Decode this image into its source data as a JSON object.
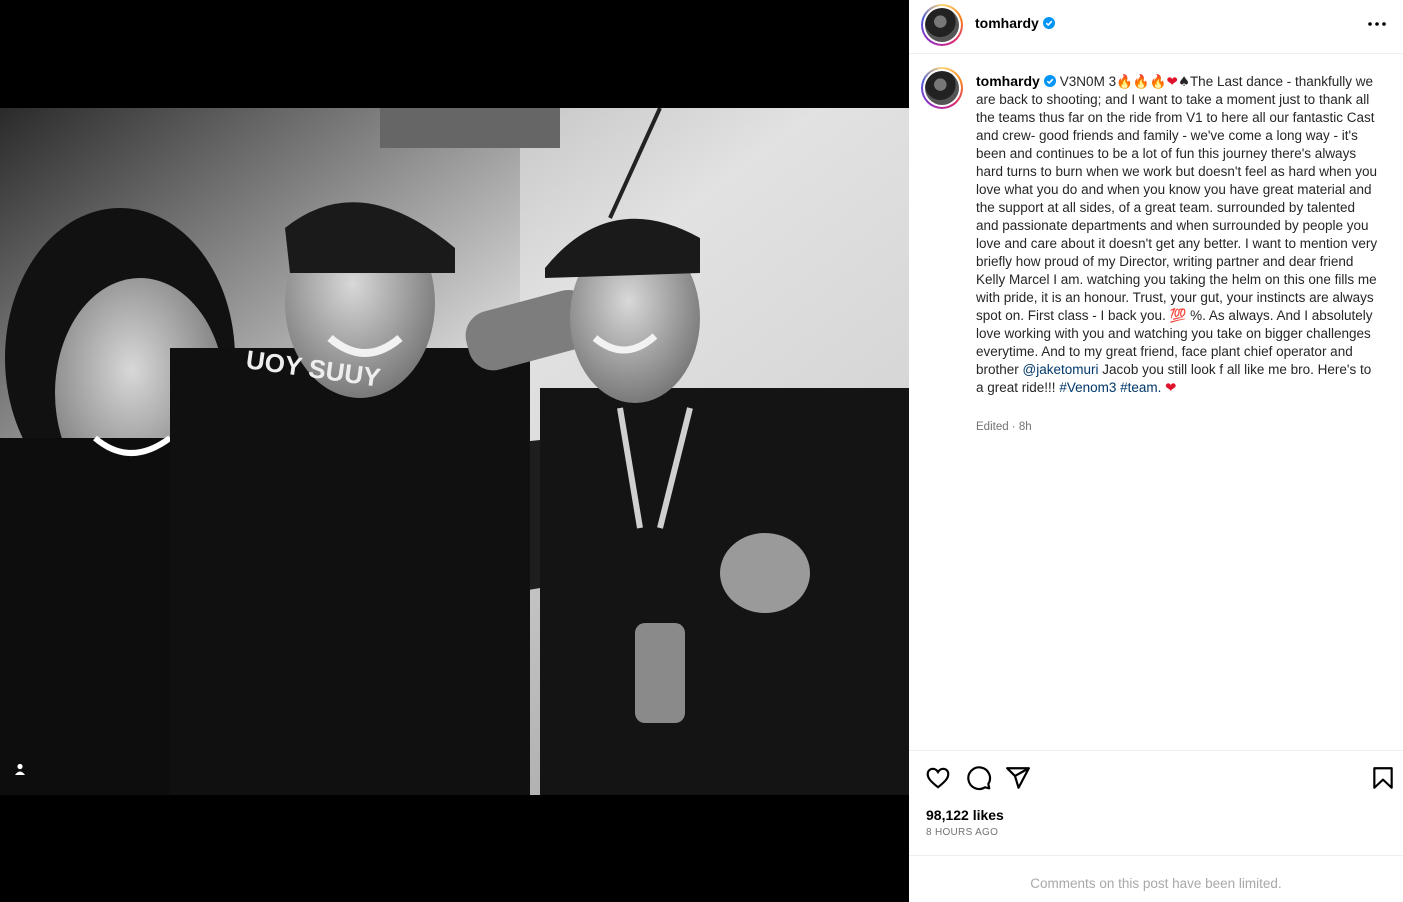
{
  "post": {
    "username": "tomhardy",
    "caption_title": "V3N0M 3",
    "caption_emoji_fire": "🔥🔥🔥",
    "caption_emoji_heart": "❤",
    "caption_emoji_spade": "♠",
    "caption_p1": "The Last dance - thankfully we are back to shooting; and I want to take a moment just to thank all the teams thus far on the ride from V1 to here all our fantastic Cast and crew- good friends and family - we've come a long way - it's been and continues to be a lot of fun this journey there's always hard turns to burn when we work but doesn't feel as hard when you love what you do and when you know you have great material and the support at all sides, of a great team. surrounded by talented and passionate departments and when surrounded by people you love and care about it doesn't get any better. I want to mention very briefly how proud of my Director, writing partner and dear friend Kelly Marcel I am. watching you taking the helm on this one fills me with pride, it is an honour. Trust, your gut, your instincts are always spot on. First class - I back you.",
    "caption_emoji_100": "💯",
    "caption_p2": "%. As always. And I absolutely love working with you and watching you take on bigger challenges everytime. And to my great friend, face plant chief operator and brother",
    "mention": "@jaketomuri",
    "caption_p3": "Jacob you still look f all like me bro. Here's to a great ride!!!",
    "hashtag_1": "#Venom3",
    "hashtag_2": "#team.",
    "caption_end_heart": "❤",
    "edited": "Edited · 8h",
    "likes": "98,122 likes",
    "time_ago": "8 HOURS AGO",
    "comments_notice": "Comments on this post have been limited."
  },
  "icons": {
    "verified": "verified-badge-icon",
    "more": "more-options-icon",
    "like": "heart-icon",
    "comment": "comment-icon",
    "share": "share-icon",
    "save": "bookmark-icon",
    "tagged": "user-tag-icon"
  },
  "colors": {
    "verified_blue": "#0095f6",
    "link": "#00376b",
    "muted": "#737373",
    "background_media": "#000000",
    "panel": "#ffffff"
  }
}
